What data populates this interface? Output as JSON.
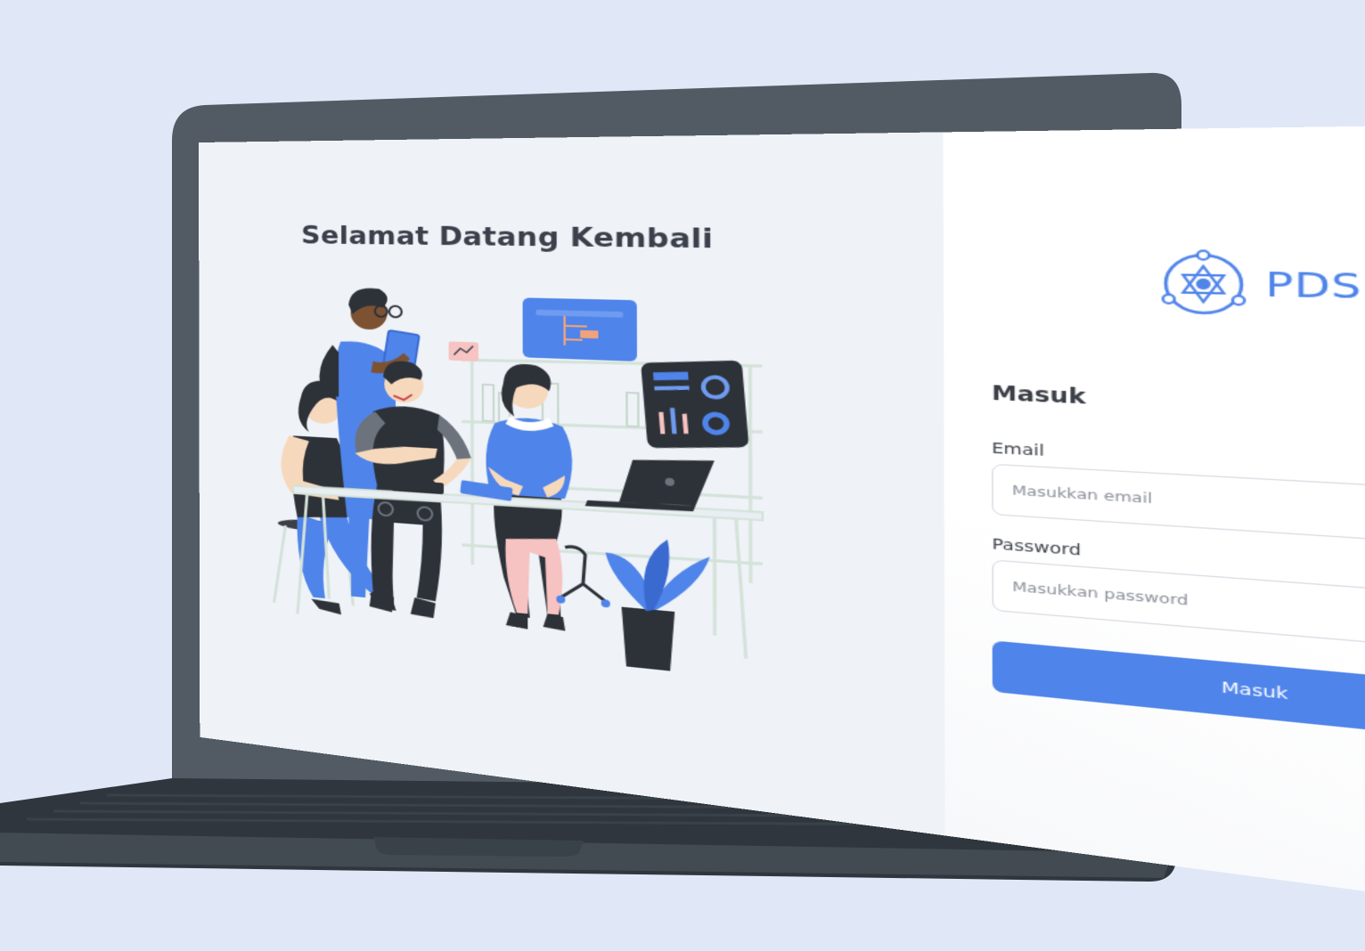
{
  "welcome": {
    "title": "Selamat Datang Kembali"
  },
  "brand": {
    "name": "PDS"
  },
  "login": {
    "title": "Masuk",
    "email_label": "Email",
    "email_placeholder": "Masukkan email",
    "password_label": "Password",
    "password_placeholder": "Masukkan password",
    "submit_label": "Masuk"
  },
  "colors": {
    "accent": "#4f84ea",
    "background": "#e0e8f8",
    "laptop_body": "#525b64",
    "left_panel": "#eff3f8"
  }
}
